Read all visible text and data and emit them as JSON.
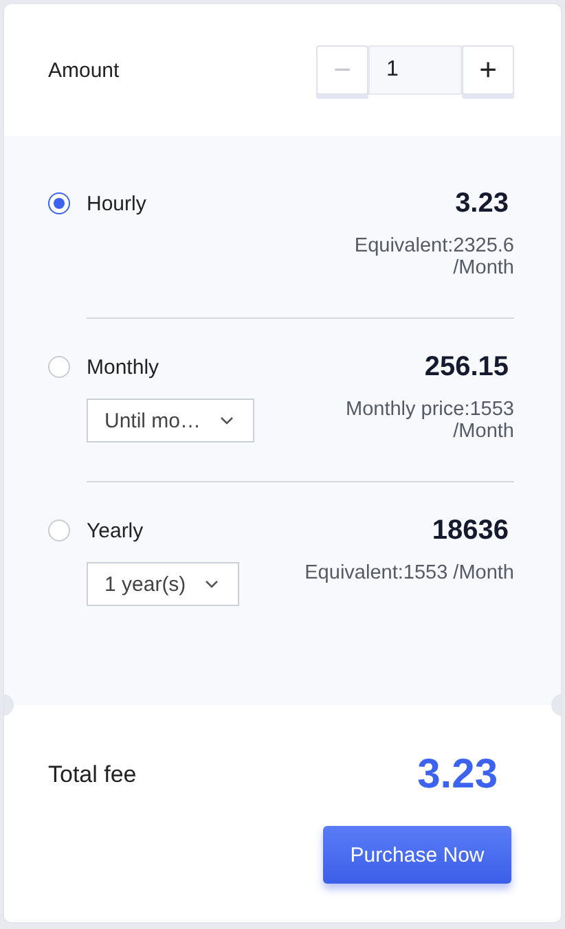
{
  "amount": {
    "label": "Amount",
    "value": "1",
    "minus": "−",
    "plus": "+",
    "minus_disabled": true
  },
  "plans": [
    {
      "label": "Hourly",
      "price": "3.23",
      "selected": true,
      "note_lines": [
        "Equivalent:2325.6",
        "/Month"
      ]
    },
    {
      "label": "Monthly",
      "price": "256.15",
      "selected": false,
      "dropdown": "Until mo…",
      "note_lines": [
        "Monthly price:1553",
        "/Month"
      ]
    },
    {
      "label": "Yearly",
      "price": "18636",
      "selected": false,
      "dropdown": "1 year(s)",
      "note_lines": [
        "Equivalent:1553 /Month"
      ]
    }
  ],
  "total": {
    "label": "Total fee",
    "value": "3.23"
  },
  "purchase_button": "Purchase Now"
}
